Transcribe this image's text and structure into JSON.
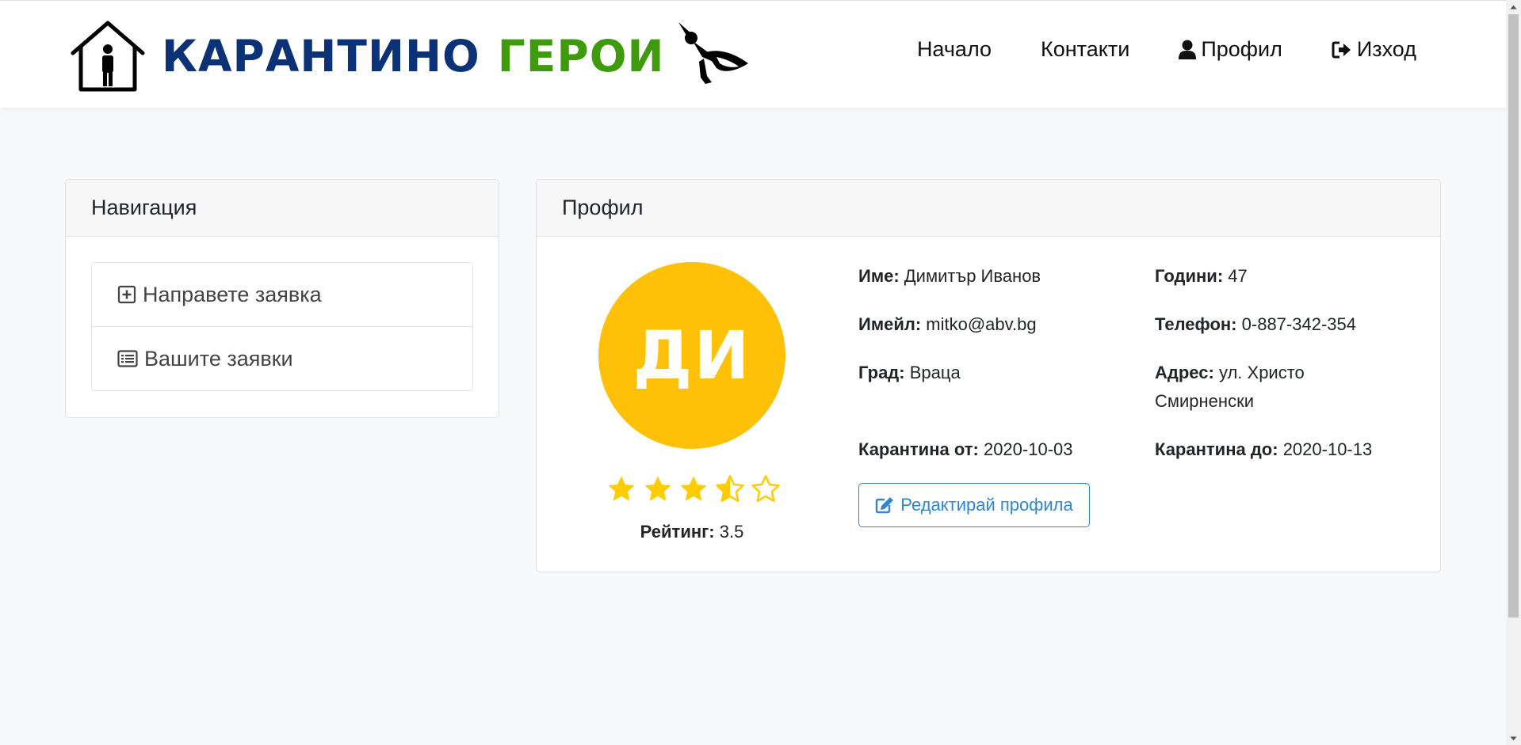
{
  "brand": {
    "word1": "КАРАНТИНО",
    "word2": "ГЕРОИ",
    "color_primary": "#0b3277",
    "color_secondary": "#3f9a0c"
  },
  "nav": {
    "home": "Начало",
    "contacts": "Контакти",
    "profile": "Профил",
    "logout": "Изход"
  },
  "sidebar": {
    "title": "Навигация",
    "items": [
      {
        "label": "Направете заявка",
        "icon": "plus-square-icon"
      },
      {
        "label": "Вашите заявки",
        "icon": "list-icon"
      }
    ]
  },
  "profile": {
    "title": "Профил",
    "initials": "ДИ",
    "avatar_color": "#ffc107",
    "rating_value": 3.5,
    "rating_max": 5,
    "rating_label": "Рейтинг:",
    "rating_text": "3.5",
    "fields": {
      "name_label": "Име:",
      "name_value": "Димитър Иванов",
      "age_label": "Години:",
      "age_value": "47",
      "email_label": "Имейл:",
      "email_value": "mitko@abv.bg",
      "phone_label": "Телефон:",
      "phone_value": "0-887-342-354",
      "city_label": "Град:",
      "city_value": "Враца",
      "address_label": "Адрес:",
      "address_value": "ул. Христо Смирненски",
      "q_from_label": "Карантина от:",
      "q_from_value": "2020-10-03",
      "q_to_label": "Карантина до:",
      "q_to_value": "2020-10-13"
    },
    "edit_button": "Редактирай профила",
    "accent_color": "#2f86d4"
  }
}
